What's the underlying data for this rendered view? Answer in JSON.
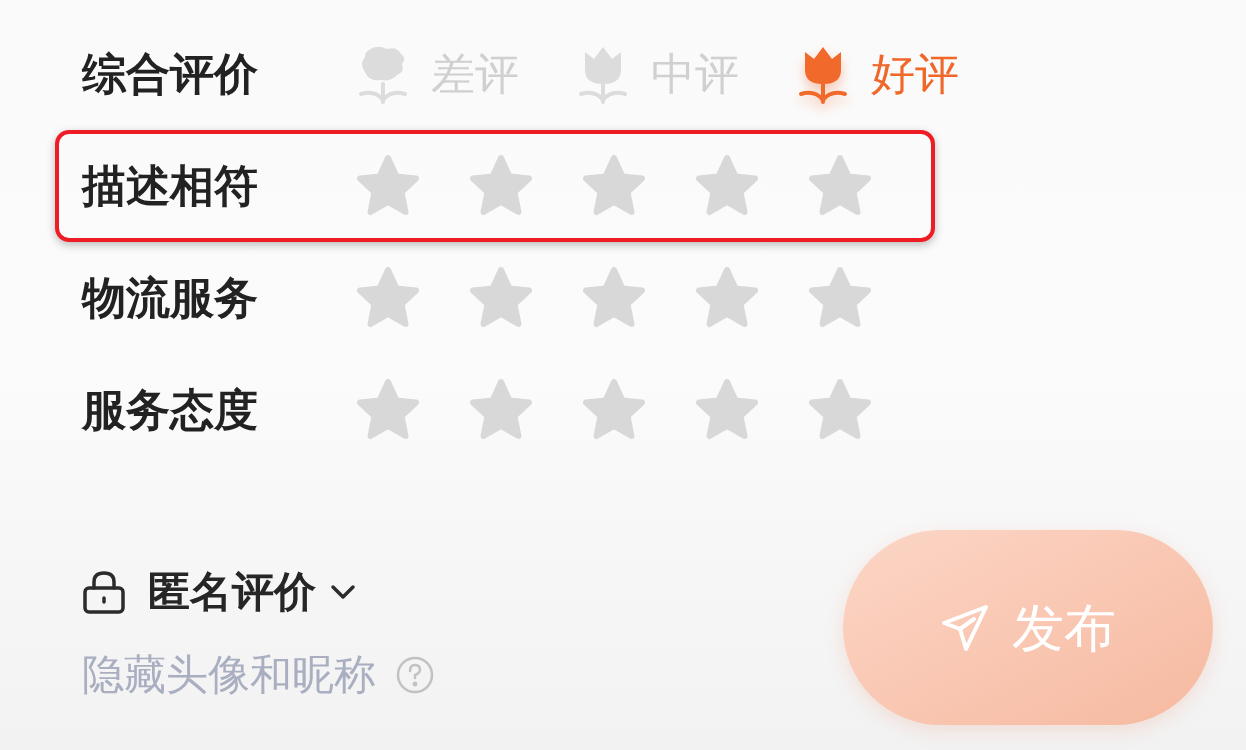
{
  "overall_rating": {
    "label": "综合评价",
    "options": [
      {
        "label": "差评",
        "kind": "bad",
        "selected": false
      },
      {
        "label": "中评",
        "kind": "neutral",
        "selected": false
      },
      {
        "label": "好评",
        "kind": "good",
        "selected": true
      }
    ]
  },
  "ratings": [
    {
      "label": "描述相符",
      "stars": 0,
      "highlighted": true
    },
    {
      "label": "物流服务",
      "stars": 0,
      "highlighted": false
    },
    {
      "label": "服务态度",
      "stars": 0,
      "highlighted": false
    }
  ],
  "anonymous": {
    "label": "匿名评价",
    "hint": "隐藏头像和昵称"
  },
  "publish_button": {
    "label": "发布"
  }
}
